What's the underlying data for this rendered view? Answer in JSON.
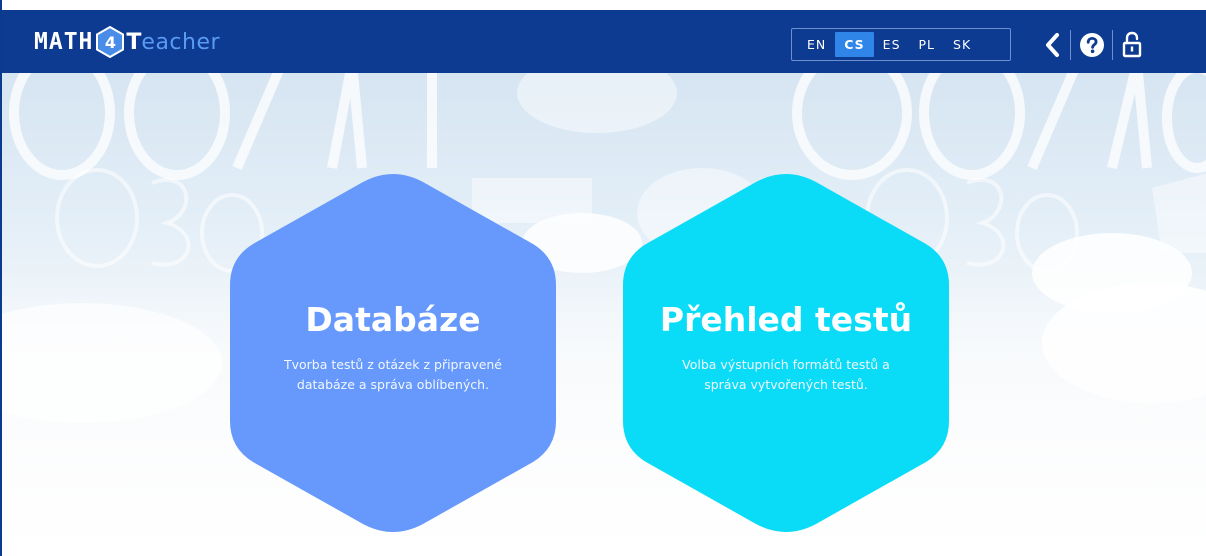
{
  "header": {
    "logo": {
      "part1": "MATH",
      "part2": "4",
      "part3": "T",
      "part4": "eacher"
    },
    "languages": [
      {
        "code": "EN",
        "active": false
      },
      {
        "code": "CS",
        "active": true
      },
      {
        "code": "ES",
        "active": false
      },
      {
        "code": "PL",
        "active": false
      },
      {
        "code": "SK",
        "active": false
      }
    ],
    "icons": {
      "back": "chevron-left-icon",
      "help": "help-circle-icon",
      "lock": "lock-open-icon"
    }
  },
  "cards": [
    {
      "title": "Databáze",
      "description": "Tvorba testů z otázek z připravené databáze a správa oblíbených.",
      "color": "#6699fb"
    },
    {
      "title": "Přehled testů",
      "description": "Volba výstupních formátů testů a správa vytvořených testů.",
      "color": "#0adcf7"
    }
  ],
  "colors": {
    "header_bg": "#0d3b91",
    "active_lang": "#2f86e8",
    "logo_accent": "#5a9bf2"
  }
}
